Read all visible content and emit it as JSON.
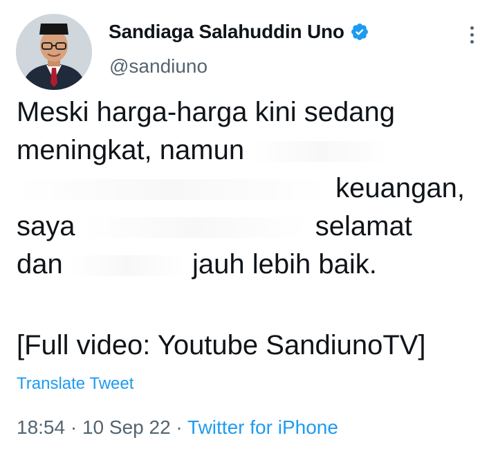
{
  "user": {
    "display_name": "Sandiaga Salahuddin Uno",
    "handle": "@sandiuno",
    "verified": true
  },
  "tweet": {
    "lines": [
      "Meski harga-harga kini sedang",
      "meningkat, namun",
      "keuangan,",
      "saya",
      "selamat",
      "dan",
      "jauh lebih baik."
    ],
    "footer_line": "[Full video: Youtube SandiunoTV]",
    "translate_label": "Translate Tweet",
    "time": "18:54",
    "separator": "·",
    "date": "10 Sep 22",
    "source": "Twitter for iPhone"
  },
  "colors": {
    "accent": "#1d9bf0",
    "text": "#0f1419",
    "muted": "#536471"
  },
  "icons": {
    "verified": "verified-badge-icon",
    "more": "more-options-icon"
  }
}
